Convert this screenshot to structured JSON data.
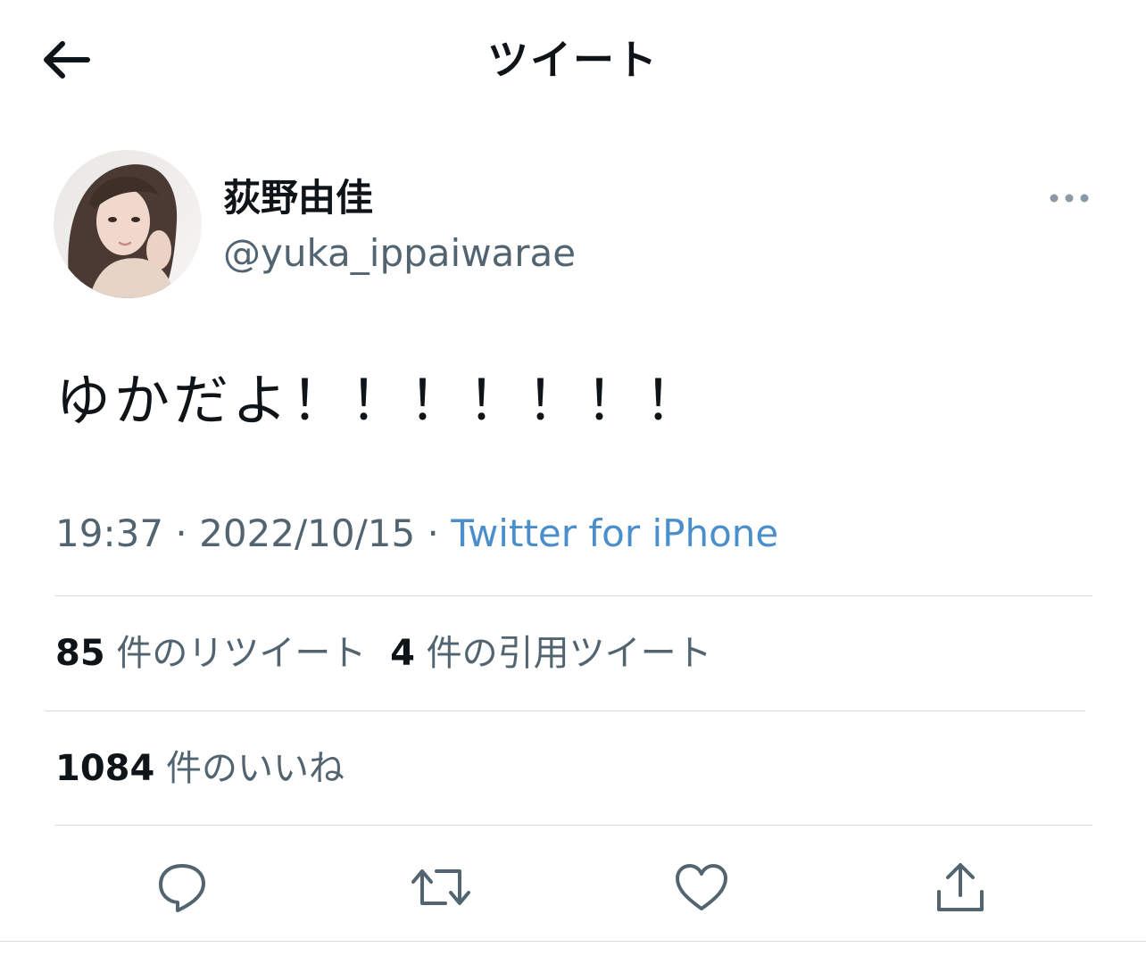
{
  "header": {
    "title": "ツイート",
    "back_icon": "arrow-left-icon"
  },
  "author": {
    "name": "荻野由佳",
    "handle": "@yuka_ippaiwarae",
    "more_icon": "more-horizontal-icon"
  },
  "tweet": {
    "text": "ゆかだよ！！！！！！！"
  },
  "meta": {
    "time": "19:37",
    "separator": " · ",
    "date": "2022/10/15",
    "source": "Twitter for iPhone"
  },
  "stats": {
    "retweets": {
      "count": "85",
      "label": "件のリツイート"
    },
    "quotes": {
      "count": "4",
      "label": "件の引用ツイート"
    },
    "likes": {
      "count": "1084",
      "label": "件のいいね"
    }
  },
  "actions": {
    "reply_icon": "reply-icon",
    "retweet_icon": "retweet-icon",
    "like_icon": "heart-icon",
    "share_icon": "share-icon"
  },
  "colors": {
    "text_primary": "#0f1419",
    "text_secondary": "#536471",
    "link": "#4a8fcc",
    "divider": "#d7dce0"
  }
}
